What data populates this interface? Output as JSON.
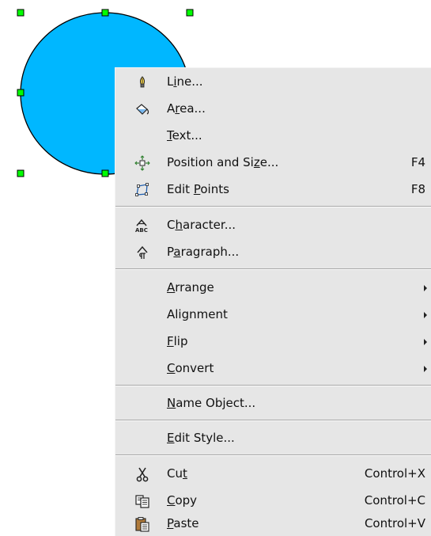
{
  "colors": {
    "shape_fill": "#00b7ff",
    "shape_stroke": "#000000",
    "handle_fill": "#00ff00",
    "menu_background": "#e6e6e6"
  },
  "context_menu": {
    "items": [
      {
        "label": "Line...",
        "mnemonic": "i",
        "icon": "line-icon",
        "shortcut": "",
        "submenu": false
      },
      {
        "label": "Area...",
        "mnemonic": "r",
        "icon": "area-icon",
        "shortcut": "",
        "submenu": false
      },
      {
        "label": "Text...",
        "mnemonic": "T",
        "icon": "",
        "shortcut": "",
        "submenu": false
      },
      {
        "label": "Position and Size...",
        "mnemonic": "z",
        "icon": "position-size-icon",
        "shortcut": "F4",
        "submenu": false
      },
      {
        "label": "Edit Points",
        "mnemonic": "P",
        "icon": "edit-points-icon",
        "shortcut": "F8",
        "submenu": false
      },
      {
        "label": "Character...",
        "mnemonic": "h",
        "icon": "character-icon",
        "shortcut": "",
        "submenu": false
      },
      {
        "label": "Paragraph...",
        "mnemonic": "a",
        "icon": "paragraph-icon",
        "shortcut": "",
        "submenu": false
      },
      {
        "label": "Arrange",
        "mnemonic": "A",
        "icon": "",
        "shortcut": "",
        "submenu": true
      },
      {
        "label": "Alignment",
        "mnemonic": "",
        "icon": "",
        "shortcut": "",
        "submenu": true
      },
      {
        "label": "Flip",
        "mnemonic": "F",
        "icon": "",
        "shortcut": "",
        "submenu": true
      },
      {
        "label": "Convert",
        "mnemonic": "C",
        "icon": "",
        "shortcut": "",
        "submenu": true
      },
      {
        "label": "Name Object...",
        "mnemonic": "N",
        "icon": "",
        "shortcut": "",
        "submenu": false
      },
      {
        "label": "Edit Style...",
        "mnemonic": "E",
        "icon": "",
        "shortcut": "",
        "submenu": false
      },
      {
        "label": "Cut",
        "mnemonic": "t",
        "icon": "scissors-icon",
        "shortcut": "Control+X",
        "submenu": false
      },
      {
        "label": "Copy",
        "mnemonic": "C",
        "icon": "copy-icon",
        "shortcut": "Control+C",
        "submenu": false
      },
      {
        "label": "Paste",
        "mnemonic": "P",
        "icon": "paste-icon",
        "shortcut": "Control+V",
        "submenu": false
      }
    ]
  }
}
